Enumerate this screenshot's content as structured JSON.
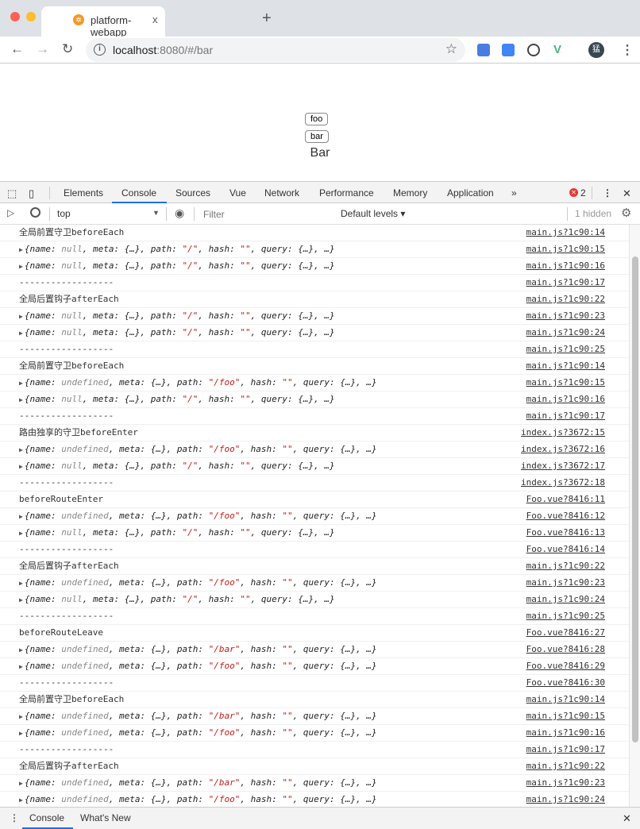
{
  "browser": {
    "tab_title": "platform-webapp",
    "tab_close": "x",
    "new_tab": "+",
    "url_host": "localhost",
    "url_rest": ":8080/#/bar",
    "avatar_initial": "猛"
  },
  "page": {
    "buttons": [
      "foo",
      "bar"
    ],
    "title": "Bar"
  },
  "devtools": {
    "tabs": [
      "Elements",
      "Console",
      "Sources",
      "Vue",
      "Network",
      "Performance",
      "Memory",
      "Application"
    ],
    "active_tab": "Console",
    "more": "»",
    "error_count": "2",
    "close": "✕",
    "context": "top",
    "filter_placeholder": "Filter",
    "levels": "Default levels ▾",
    "hidden": "1 hidden",
    "drawer_tabs": [
      "Console",
      "What's New"
    ]
  },
  "preview_keys": {
    "name": "name: ",
    "meta": ", meta: {…}, path: ",
    "hash": ", hash: ",
    "empty": "\"\"",
    "query": ", query: {…}, …}",
    "open": "{"
  },
  "console": [
    {
      "type": "log",
      "text": "全局前置守卫beforeEach",
      "src": "main.js?1c90:14"
    },
    {
      "type": "obj",
      "name": "null",
      "path": "\"/\"",
      "src": "main.js?1c90:15"
    },
    {
      "type": "obj",
      "name": "null",
      "path": "\"/\"",
      "src": "main.js?1c90:16"
    },
    {
      "type": "log",
      "text": "------------------",
      "src": "main.js?1c90:17"
    },
    {
      "type": "log",
      "text": "全局后置钩子afterEach",
      "src": "main.js?1c90:22"
    },
    {
      "type": "obj",
      "name": "null",
      "path": "\"/\"",
      "src": "main.js?1c90:23"
    },
    {
      "type": "obj",
      "name": "null",
      "path": "\"/\"",
      "src": "main.js?1c90:24"
    },
    {
      "type": "log",
      "text": "------------------",
      "src": "main.js?1c90:25"
    },
    {
      "type": "log",
      "text": "全局前置守卫beforeEach",
      "src": "main.js?1c90:14"
    },
    {
      "type": "obj",
      "name": "undefined",
      "path": "\"/foo\"",
      "src": "main.js?1c90:15"
    },
    {
      "type": "obj",
      "name": "null",
      "path": "\"/\"",
      "src": "main.js?1c90:16"
    },
    {
      "type": "log",
      "text": "------------------",
      "src": "main.js?1c90:17"
    },
    {
      "type": "log",
      "text": "路由独享的守卫beforeEnter",
      "src": "index.js?3672:15"
    },
    {
      "type": "obj",
      "name": "undefined",
      "path": "\"/foo\"",
      "src": "index.js?3672:16"
    },
    {
      "type": "obj",
      "name": "null",
      "path": "\"/\"",
      "src": "index.js?3672:17"
    },
    {
      "type": "log",
      "text": "------------------",
      "src": "index.js?3672:18"
    },
    {
      "type": "log",
      "text": "beforeRouteEnter",
      "src": "Foo.vue?8416:11"
    },
    {
      "type": "obj",
      "name": "undefined",
      "path": "\"/foo\"",
      "src": "Foo.vue?8416:12"
    },
    {
      "type": "obj",
      "name": "null",
      "path": "\"/\"",
      "src": "Foo.vue?8416:13"
    },
    {
      "type": "log",
      "text": "------------------",
      "src": "Foo.vue?8416:14"
    },
    {
      "type": "log",
      "text": "全局后置钩子afterEach",
      "src": "main.js?1c90:22"
    },
    {
      "type": "obj",
      "name": "undefined",
      "path": "\"/foo\"",
      "src": "main.js?1c90:23"
    },
    {
      "type": "obj",
      "name": "null",
      "path": "\"/\"",
      "src": "main.js?1c90:24"
    },
    {
      "type": "log",
      "text": "------------------",
      "src": "main.js?1c90:25"
    },
    {
      "type": "log",
      "text": "beforeRouteLeave",
      "src": "Foo.vue?8416:27"
    },
    {
      "type": "obj",
      "name": "undefined",
      "path": "\"/bar\"",
      "src": "Foo.vue?8416:28"
    },
    {
      "type": "obj",
      "name": "undefined",
      "path": "\"/foo\"",
      "src": "Foo.vue?8416:29"
    },
    {
      "type": "log",
      "text": "------------------",
      "src": "Foo.vue?8416:30"
    },
    {
      "type": "log",
      "text": "全局前置守卫beforeEach",
      "src": "main.js?1c90:14"
    },
    {
      "type": "obj",
      "name": "undefined",
      "path": "\"/bar\"",
      "src": "main.js?1c90:15"
    },
    {
      "type": "obj",
      "name": "undefined",
      "path": "\"/foo\"",
      "src": "main.js?1c90:16"
    },
    {
      "type": "log",
      "text": "------------------",
      "src": "main.js?1c90:17"
    },
    {
      "type": "log",
      "text": "全局后置钩子afterEach",
      "src": "main.js?1c90:22"
    },
    {
      "type": "obj",
      "name": "undefined",
      "path": "\"/bar\"",
      "src": "main.js?1c90:23"
    },
    {
      "type": "obj",
      "name": "undefined",
      "path": "\"/foo\"",
      "src": "main.js?1c90:24"
    }
  ]
}
